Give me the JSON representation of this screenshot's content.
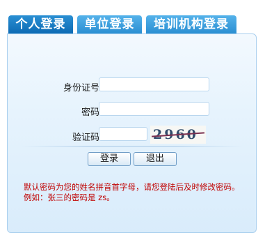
{
  "tabs": [
    {
      "label": "个人登录",
      "active": true
    },
    {
      "label": "单位登录",
      "active": false
    },
    {
      "label": "培训机构登录",
      "active": false
    }
  ],
  "form": {
    "id_label": "身份证号",
    "id_value": "",
    "password_label": "密码",
    "password_value": "",
    "captcha_label": "验证码",
    "captcha_value": "",
    "captcha_text": "2960"
  },
  "buttons": {
    "login": "登录",
    "exit": "退出"
  },
  "notice": {
    "line1": "默认密码为您的姓名拼音首字母，请您登陆后及时修改密码。",
    "line2": "例如：张三的密码是 zs。"
  },
  "colors": {
    "accent": "#1b7cc4",
    "notice": "#c00000"
  }
}
